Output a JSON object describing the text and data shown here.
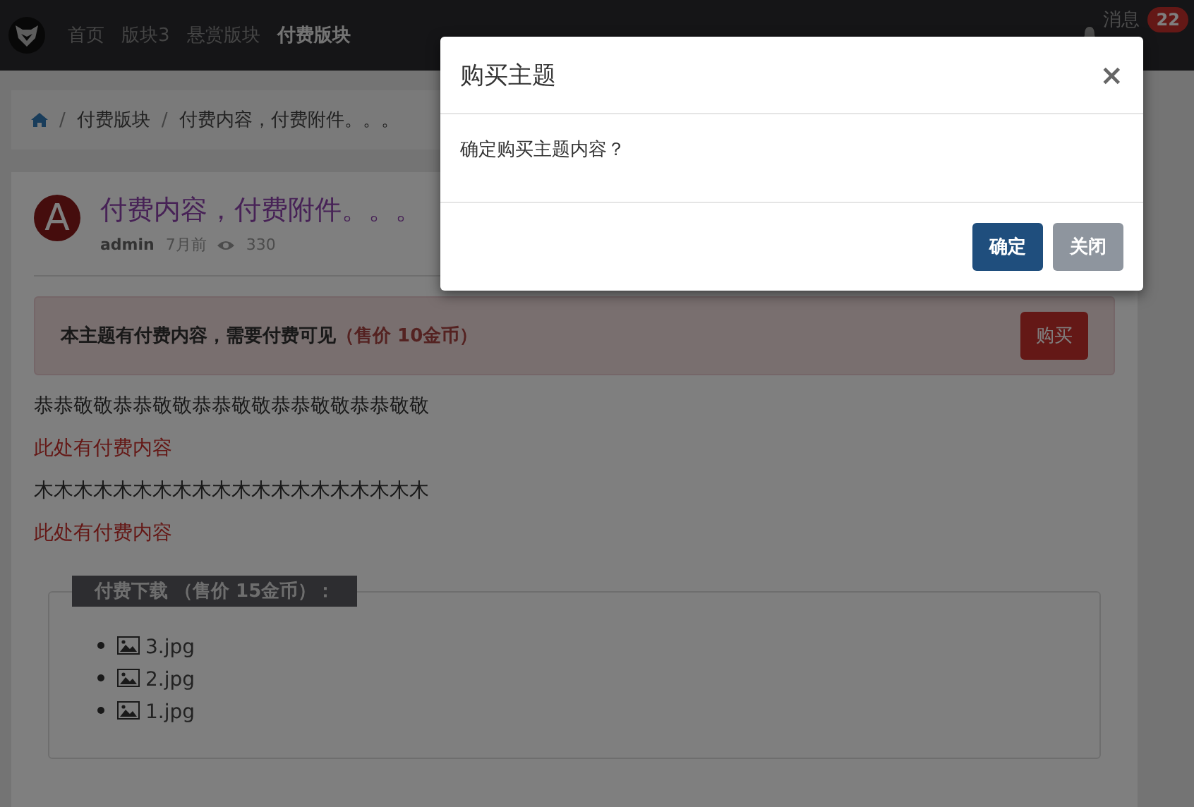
{
  "navbar": {
    "tabs": [
      {
        "label": "首页",
        "selected": false
      },
      {
        "label": "版块3",
        "selected": false
      },
      {
        "label": "悬赏版块",
        "selected": false
      },
      {
        "label": "付费版块",
        "selected": true
      }
    ],
    "messages": {
      "label": "消息",
      "count": "22"
    }
  },
  "breadcrumb": {
    "separator": "/",
    "items": [
      "付费版块",
      "付费内容，付费附件。。。"
    ]
  },
  "post": {
    "avatar": "A",
    "title": "付费内容，付费附件。。。",
    "author": "admin",
    "time": "7月前",
    "views": "330",
    "notice": {
      "text": "本主题有付费内容，需要付费可见",
      "price": "（售价 10金币）",
      "button": "购买"
    },
    "paragraphs": [
      {
        "kind": "text",
        "text": "恭恭敬敬恭恭敬敬恭恭敬敬恭恭敬敬恭恭敬敬"
      },
      {
        "kind": "paid",
        "text": "此处有付费内容"
      },
      {
        "kind": "text",
        "text": "木木木木木木木木木木木木木木木木木木木木"
      },
      {
        "kind": "paid",
        "text": "此处有付费内容"
      }
    ],
    "downloads": {
      "legend": "付费下载 （售价 15金币）：",
      "files": [
        "3.jpg",
        "2.jpg",
        "1.jpg"
      ]
    }
  },
  "modal": {
    "title": "购买主题",
    "close": "×",
    "message": "确定购买主题内容？",
    "buttons": [
      {
        "kind": "primary",
        "label": "确定"
      },
      {
        "kind": "secondary",
        "label": "关闭"
      }
    ]
  }
}
